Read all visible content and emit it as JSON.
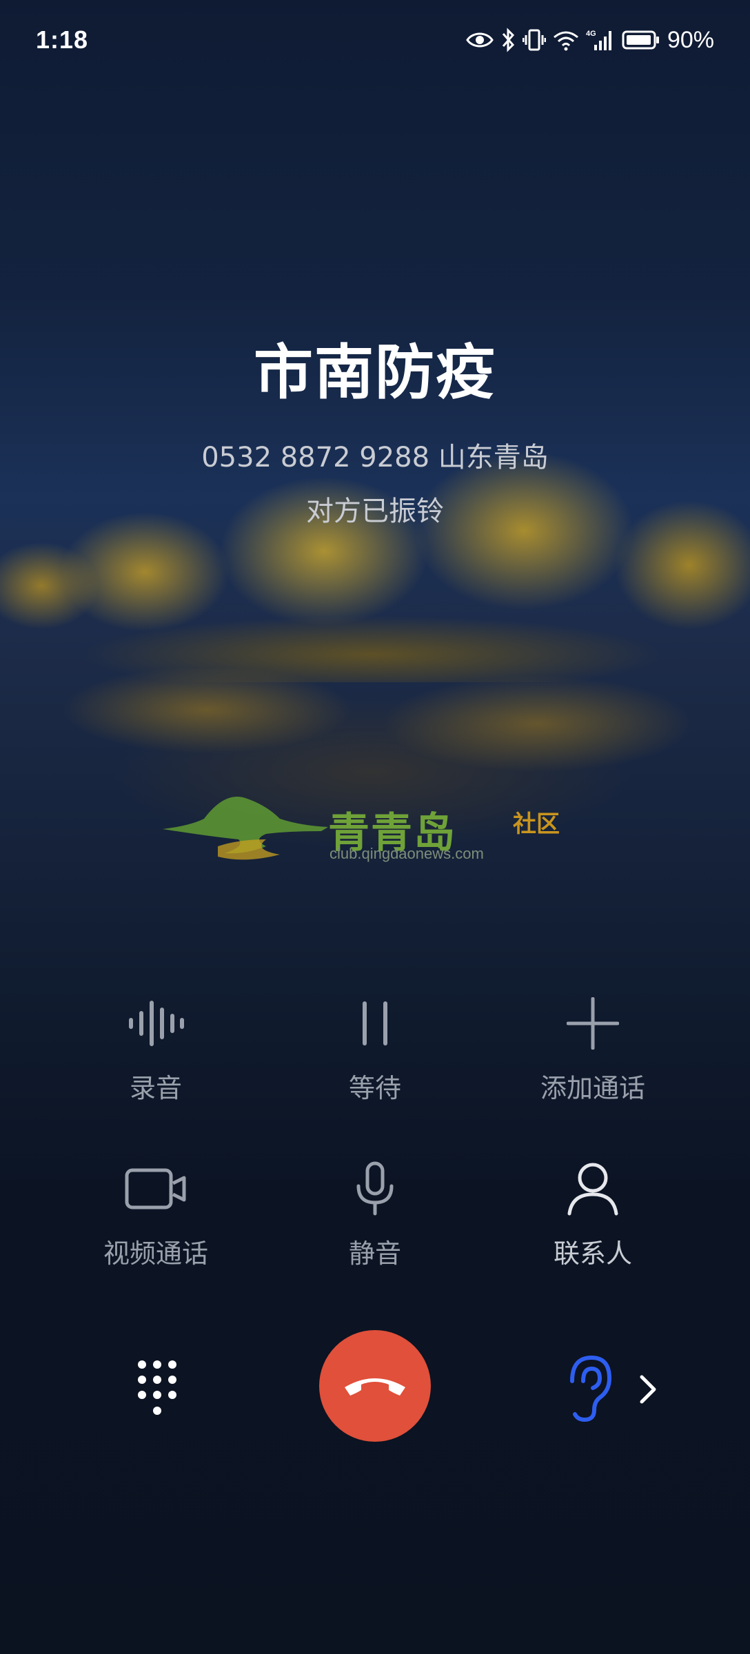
{
  "status_bar": {
    "time": "1:18",
    "battery_percent": "90%",
    "icons": [
      "eye-icon",
      "bluetooth-icon",
      "vibrate-icon",
      "wifi-icon",
      "signal-4g-icon",
      "battery-icon"
    ]
  },
  "caller": {
    "name": "市南防疫",
    "number_location": "0532 8872 9288  山东青岛",
    "status": "对方已振铃"
  },
  "watermark": {
    "title": "青青岛",
    "subtitle": "社区",
    "url": "club.qingdaonews.com"
  },
  "controls": {
    "record": "录音",
    "hold": "等待",
    "add_call": "添加通话",
    "video_call": "视频通话",
    "mute": "静音",
    "contacts": "联系人"
  },
  "colors": {
    "end_call": "#e0503a",
    "earpiece_icon": "#2e5ef0"
  }
}
